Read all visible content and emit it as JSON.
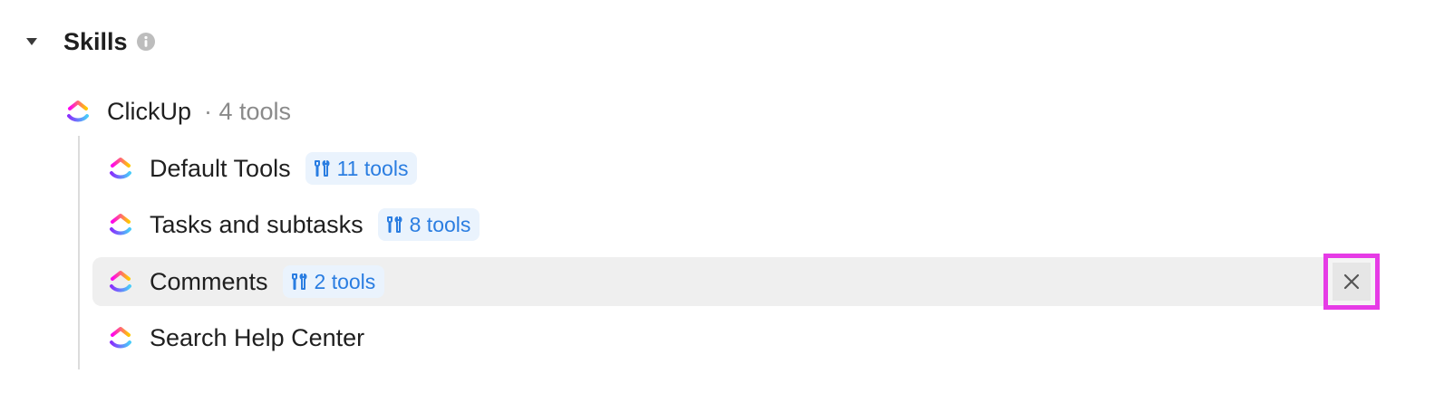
{
  "section": {
    "title": "Skills",
    "toggle_icon": "caret-down-icon",
    "info_icon": "info-icon"
  },
  "group": {
    "name": "ClickUp",
    "count_label": "· 4 tools",
    "logo_icon": "clickup-logo-icon"
  },
  "skills": [
    {
      "label": "Default Tools",
      "badge": "11 tools",
      "badge_icon": "tools-icon",
      "selected": false
    },
    {
      "label": "Tasks and subtasks",
      "badge": "8 tools",
      "badge_icon": "tools-icon",
      "selected": false
    },
    {
      "label": "Comments",
      "badge": "2 tools",
      "badge_icon": "tools-icon",
      "selected": true
    },
    {
      "label": "Search Help Center",
      "badge": "",
      "selected": false
    }
  ],
  "remove_icon": "close-icon",
  "colors": {
    "badge_text": "#2a7de1",
    "badge_bg": "#eaf3fd",
    "selected_row_bg": "#efefef",
    "highlight_border": "#e63be6",
    "muted_text": "#8a8a8a"
  }
}
